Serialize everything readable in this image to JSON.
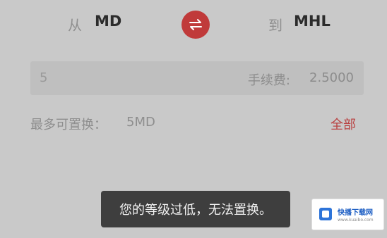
{
  "conversion": {
    "from_label": "从",
    "from_value": "MD",
    "to_label": "到",
    "to_value": "MHL"
  },
  "input": {
    "amount": "5",
    "fee_label": "手续费:",
    "fee_value": "2.5000"
  },
  "max": {
    "label": "最多可置换：",
    "value": "5MD",
    "all_label": "全部"
  },
  "toast": {
    "message": "您的等级过低，无法置换。"
  },
  "watermark": {
    "title": "快播下载网",
    "url": "www.kuaibo.com"
  },
  "colors": {
    "accent": "#c03a3a",
    "background": "#c9c9c9",
    "toast_bg": "#3e3e3e"
  },
  "icons": {
    "swap": "swap-arrows-icon",
    "brand": "brand-logo-icon"
  }
}
